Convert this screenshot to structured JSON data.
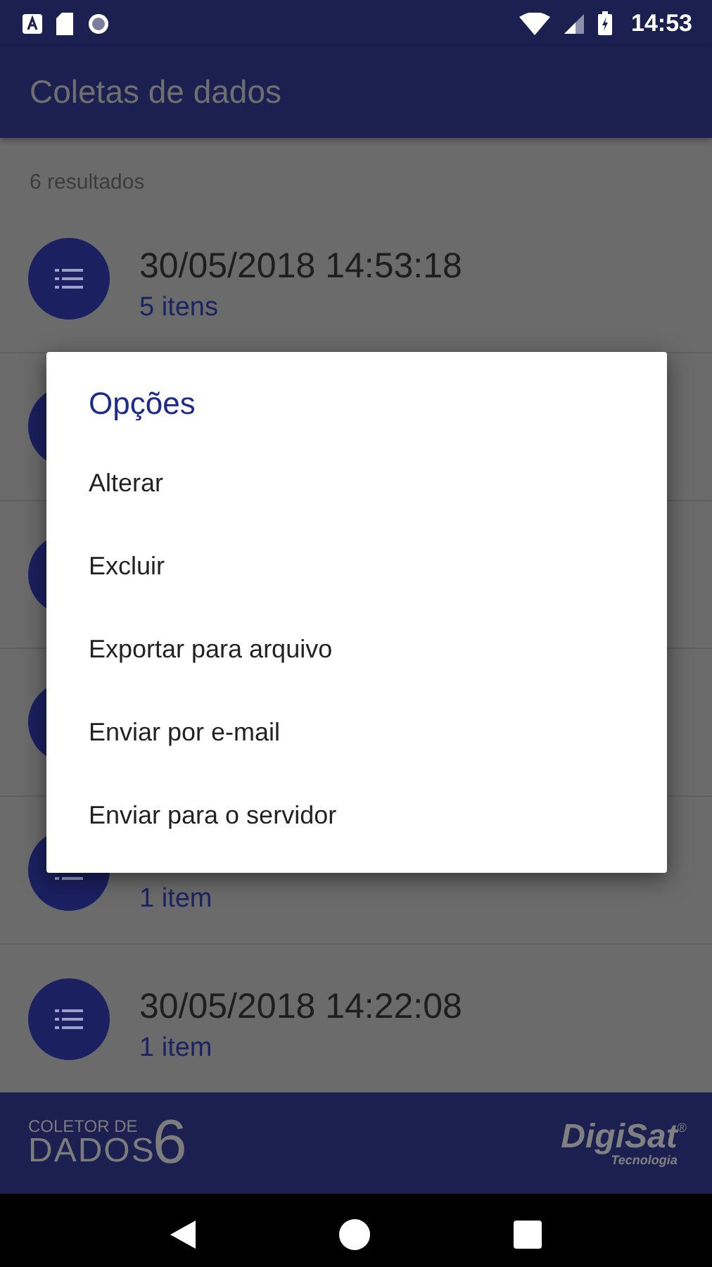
{
  "status_bar": {
    "time": "14:53"
  },
  "app_bar": {
    "title": "Coletas de dados"
  },
  "list": {
    "count": "6 resultados",
    "rows": [
      {
        "title": "30/05/2018 14:53:18",
        "subtitle": "5 itens"
      },
      {},
      {},
      {},
      {
        "subtitle": "1 item"
      },
      {
        "title": "30/05/2018 14:22:08",
        "subtitle": "1 item"
      }
    ]
  },
  "dialog": {
    "title": "Opções",
    "options": [
      "Alterar",
      "Excluir",
      "Exportar para arquivo",
      "Enviar por e-mail",
      "Enviar para o servidor"
    ]
  },
  "footer": {
    "app_logo": {
      "line_1": "COLETOR DE",
      "line_2": "DADOS",
      "number": "6"
    },
    "company_logo": {
      "name": "DigiSat",
      "mark": "®",
      "tagline": "Tecnologia"
    }
  }
}
